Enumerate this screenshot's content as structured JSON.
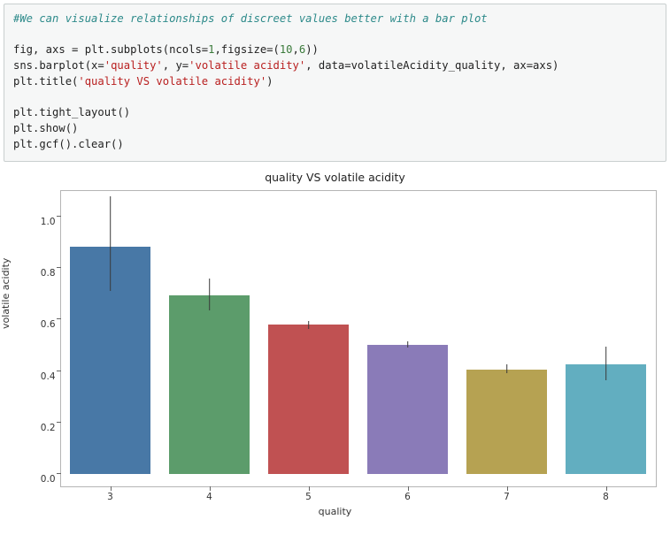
{
  "code": {
    "comment": "#We can visualize relationships of discreet values better with a bar plot",
    "l2a": "fig, axs = plt.subplots(ncols=",
    "l2n1": "1",
    "l2b": ",figsize=(",
    "l2n2": "10",
    "l2c": ",",
    "l2n3": "6",
    "l2d": "))",
    "l3a": "sns.barplot(x=",
    "l3s1": "'quality'",
    "l3b": ", y=",
    "l3s2": "'volatile acidity'",
    "l3c": ", data=volatileAcidity_quality, ax=axs)",
    "l4a": "plt.title(",
    "l4s": "'quality VS volatile acidity'",
    "l4b": ")",
    "l6": "plt.tight_layout()",
    "l7": "plt.show()",
    "l8": "plt.gcf().clear()"
  },
  "chart_data": {
    "type": "bar",
    "title": "quality VS volatile acidity",
    "xlabel": "quality",
    "ylabel": "volatile acidity",
    "categories": [
      "3",
      "4",
      "5",
      "6",
      "7",
      "8"
    ],
    "values": [
      0.885,
      0.695,
      0.58,
      0.5,
      0.405,
      0.425
    ],
    "err_low": [
      0.71,
      0.635,
      0.565,
      0.49,
      0.39,
      0.365
    ],
    "err_high": [
      1.08,
      0.76,
      0.595,
      0.515,
      0.425,
      0.495
    ],
    "colors": [
      "#4878a6",
      "#5c9c6b",
      "#c05152",
      "#8a7bb8",
      "#b6a252",
      "#62aec0"
    ],
    "yticks": [
      0.0,
      0.2,
      0.4,
      0.6,
      0.8,
      1.0
    ],
    "ylim": [
      -0.05,
      1.1
    ]
  }
}
